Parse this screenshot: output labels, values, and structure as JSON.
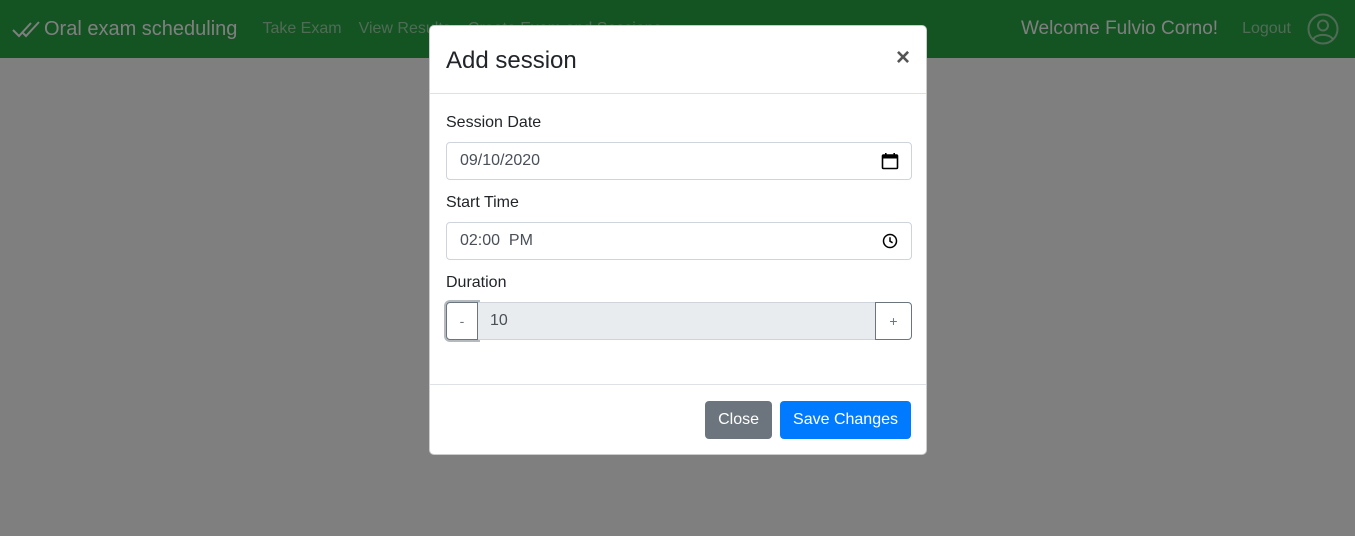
{
  "navbar": {
    "brand": "Oral exam scheduling",
    "links": [
      "Take Exam",
      "View Results",
      "Create Exam and Sessions"
    ],
    "welcome": "Welcome Fulvio Corno!",
    "logout": "Logout",
    "icons": {
      "brand": "double-check-icon",
      "avatar": "user-circle-icon"
    },
    "color": "#28a745"
  },
  "modal": {
    "title": "Add session",
    "close_symbol": "×",
    "fields": {
      "date": {
        "label": "Session Date",
        "value": "09/10/2020",
        "icon": "calendar-icon"
      },
      "time": {
        "label": "Start Time",
        "value": "02:00  PM",
        "icon": "clock-icon"
      },
      "duration": {
        "label": "Duration",
        "value": "10",
        "minus": "-",
        "plus": "+"
      }
    },
    "buttons": {
      "close": "Close",
      "save": "Save Changes"
    },
    "colors": {
      "primary": "#007bff",
      "secondary": "#6c757d"
    }
  }
}
